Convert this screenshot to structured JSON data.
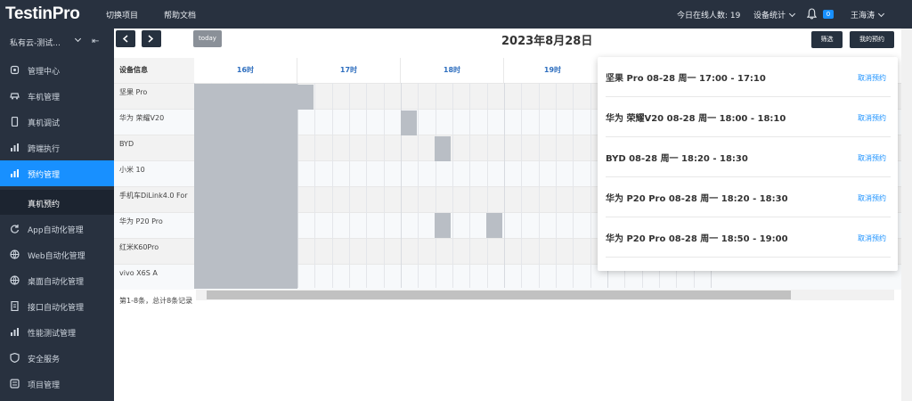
{
  "app": {
    "logo": "TestinPro"
  },
  "topnav": {
    "items": [
      "切换项目",
      "帮助文档"
    ],
    "online_label": "今日在线人数: 19",
    "device_stats": "设备统计",
    "badge": "0",
    "user": "王海涛"
  },
  "sidebar": {
    "workspace": "私有云-测试...",
    "items": [
      {
        "label": "管理中心",
        "icon": "home-icon"
      },
      {
        "label": "车机管理",
        "icon": "car-icon"
      },
      {
        "label": "真机调试",
        "icon": "phone-icon"
      },
      {
        "label": "跨端执行",
        "icon": "bar-icon"
      },
      {
        "label": "预约管理",
        "icon": "bar-icon"
      },
      {
        "label": "App自动化管理",
        "icon": "refresh-icon"
      },
      {
        "label": "Web自动化管理",
        "icon": "globe-icon"
      },
      {
        "label": "桌面自动化管理",
        "icon": "globe-icon"
      },
      {
        "label": "接口自动化管理",
        "icon": "document-icon"
      },
      {
        "label": "性能测试管理",
        "icon": "bar-icon"
      },
      {
        "label": "安全服务",
        "icon": "shield-icon"
      },
      {
        "label": "项目管理",
        "icon": "list-icon"
      }
    ],
    "sub_item": "真机预约"
  },
  "toolbar": {
    "today": "today",
    "date_title": "2023年8月28日",
    "filter": "筛选",
    "my_reservations": "我的预约"
  },
  "schedule": {
    "device_header": "设备信息",
    "hours": [
      "16时",
      "17时",
      "18时",
      "19时"
    ],
    "devices": [
      "坚果 Pro",
      "华为 荣耀V20",
      "BYD",
      "小米 10",
      "手机车DiLink4.0 For",
      "华为 P20 Pro",
      "红米K60Pro",
      "vivo X6S A"
    ],
    "footer": "第1-8条，总计8条记录"
  },
  "reservations": [
    {
      "text": "坚果 Pro 08-28 周一 17:00 - 17:10",
      "cancel": "取消预约"
    },
    {
      "text": "华为 荣耀V20 08-28 周一 18:00 - 18:10",
      "cancel": "取消预约"
    },
    {
      "text": "BYD 08-28 周一 18:20 - 18:30",
      "cancel": "取消预约"
    },
    {
      "text": "华为 P20 Pro 08-28 周一 18:20 - 18:30",
      "cancel": "取消预约"
    },
    {
      "text": "华为 P20 Pro 08-28 周一 18:50 - 19:00",
      "cancel": "取消预约"
    }
  ]
}
